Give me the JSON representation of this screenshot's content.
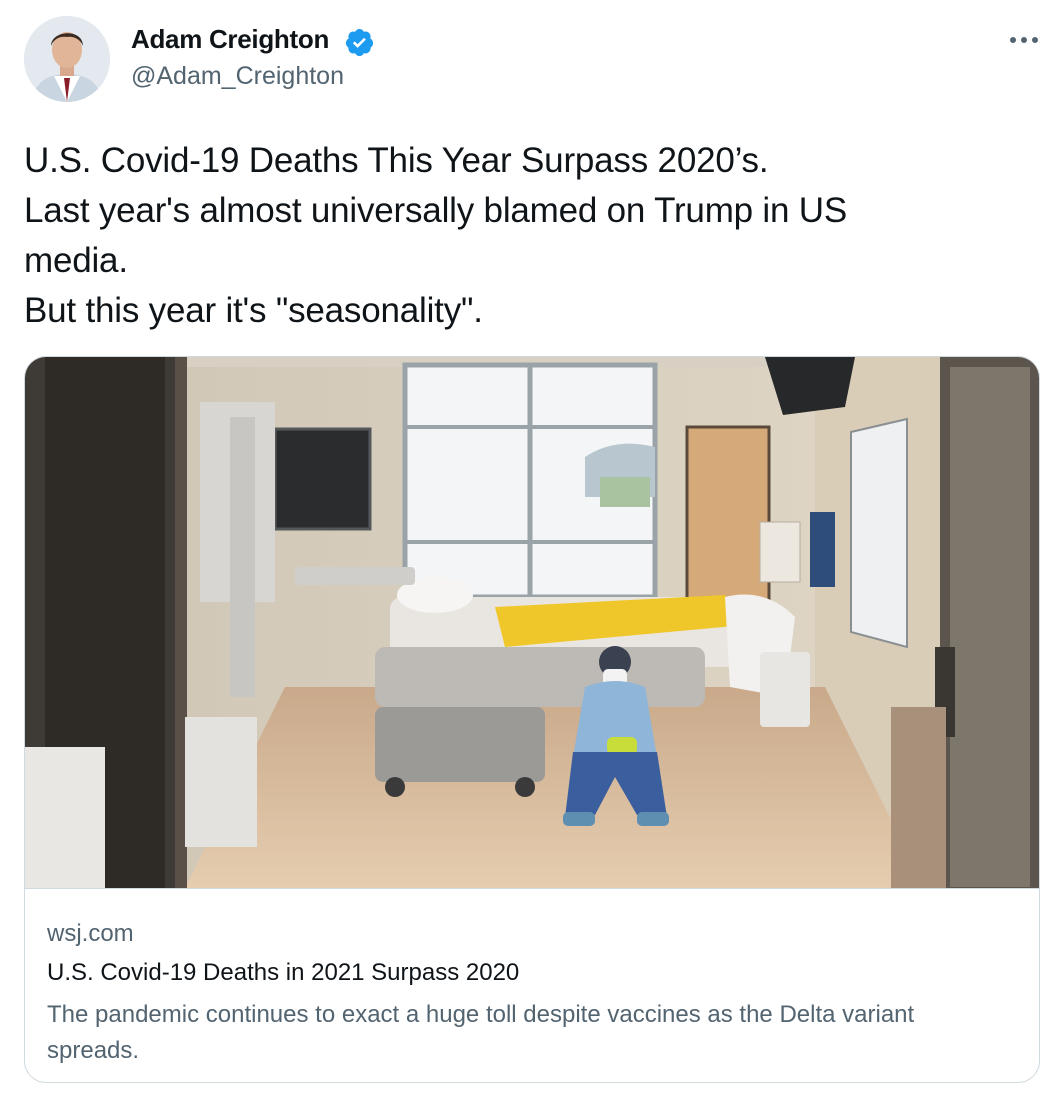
{
  "author": {
    "display_name": "Adam Creighton",
    "handle": "@Adam_Creighton",
    "verified": true,
    "avatar_icon": "profile-photo",
    "verified_icon": "verified-badge-icon",
    "verified_color": "#1d9bf0"
  },
  "menu": {
    "icon": "more-options-icon"
  },
  "tweet": {
    "lines": [
      "U.S. Covid-19 Deaths This Year Surpass 2020’s.",
      "Last year's almost universally blamed on Trump in US",
      "media.",
      "But this year it's \"seasonality\"."
    ]
  },
  "card": {
    "image_icon": "hospital-room-photo",
    "domain": "wsj.com",
    "title": "U.S. Covid-19 Deaths in 2021 Surpass 2020",
    "description": "The pandemic continues to exact a huge toll despite vaccines as the Delta variant spreads."
  },
  "colors": {
    "text_primary": "#0f1419",
    "text_secondary": "#536471",
    "border": "#cfd9de"
  }
}
